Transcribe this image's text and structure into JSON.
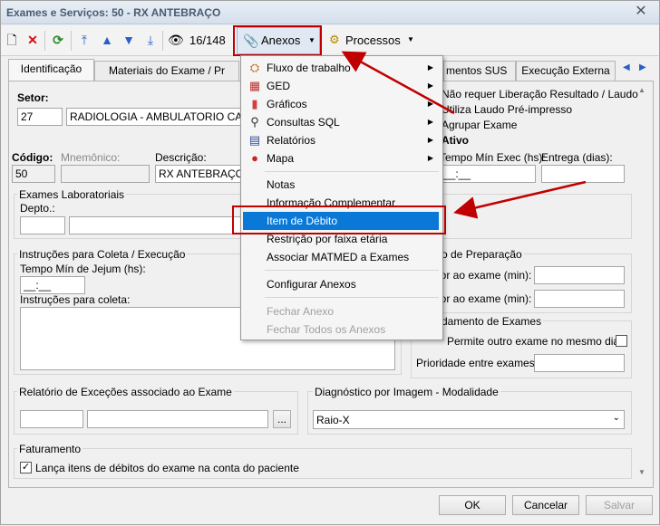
{
  "window": {
    "title": "Exames e Serviços: 50 - RX ANTEBRAÇO"
  },
  "toolbar": {
    "counter": "16/148",
    "anexos_label": "Anexos",
    "processos_label": "Processos"
  },
  "tabs": [
    "Identificação",
    "Materiais do Exame / Pr",
    "mentos SUS",
    "Execução Externa"
  ],
  "setor": {
    "label": "Setor:",
    "code": "27",
    "name": "RADIOLOGIA - AMBULATORIO CAMBU"
  },
  "options": {
    "nao_requer": "Não requer Liberação Resultado / Laudo",
    "utiliza_laudo": "Utiliza Laudo Pré-impresso",
    "agrupar": "Agrupar Exame",
    "ativo": "Ativo"
  },
  "fields": {
    "codigo_label": "Código:",
    "codigo": "50",
    "mnemonico_label": "Mnemônico:",
    "descricao_label": "Descrição:",
    "descricao": "RX ANTEBRAÇO",
    "tempo_min_label": "Tempo Mín Exec (hs):",
    "tempo_min_value": "__:__",
    "entrega_label": "Entrega (dias):"
  },
  "exames_lab": {
    "title": "Exames Laboratoriais",
    "depto_label": "Depto.:"
  },
  "instrucoes": {
    "title": "Instruções para Coleta / Execução",
    "jejum_label": "Tempo Mín de Jejum (hs):",
    "jejum_value": "__:__",
    "coleta_label": "Instruções para coleta:"
  },
  "preparacao": {
    "title": "o de Preparação",
    "anterior_label": "ior ao exame (min):",
    "posterior_label": "ior ao exame (min):"
  },
  "agendamento": {
    "title": "damento de Exames",
    "permite_label": "Permite outro exame no mesmo dia",
    "prioridade_label": "Prioridade entre exames:"
  },
  "relatorio": {
    "title": "Relatório de Exceções associado ao Exame",
    "browse": "..."
  },
  "diagnostico": {
    "title": "Diagnóstico por Imagem - Modalidade",
    "value": "Raio-X"
  },
  "faturamento": {
    "title": "Faturamento",
    "check_label": "Lança itens de débitos do exame na conta do paciente",
    "checked": true
  },
  "buttons": {
    "ok": "OK",
    "cancelar": "Cancelar",
    "salvar": "Salvar"
  },
  "menu": {
    "items": [
      {
        "label": "Fluxo de trabalho",
        "icon": "workflow-icon",
        "submenu": true
      },
      {
        "label": "GED",
        "icon": "ged-icon",
        "submenu": true
      },
      {
        "label": "Gráficos",
        "icon": "chart-icon",
        "submenu": true
      },
      {
        "label": "Consultas SQL",
        "icon": "sql-icon",
        "submenu": true
      },
      {
        "label": "Relatórios",
        "icon": "report-icon",
        "submenu": true
      },
      {
        "label": "Mapa",
        "icon": "map-pin-icon",
        "submenu": true
      },
      {
        "label": "Notas"
      },
      {
        "label": "Informação Complementar"
      },
      {
        "label": "Item de Débito",
        "selected": true
      },
      {
        "label": "Restrição por faixa etária"
      },
      {
        "label": "Associar MATMED a Exames"
      },
      {
        "label": "Configurar Anexos"
      },
      {
        "label": "Fechar Anexo",
        "disabled": true
      },
      {
        "label": "Fechar Todos os Anexos",
        "disabled": true
      }
    ]
  },
  "colors": {
    "highlight": "#0a78d7",
    "annotation": "#c00000"
  }
}
